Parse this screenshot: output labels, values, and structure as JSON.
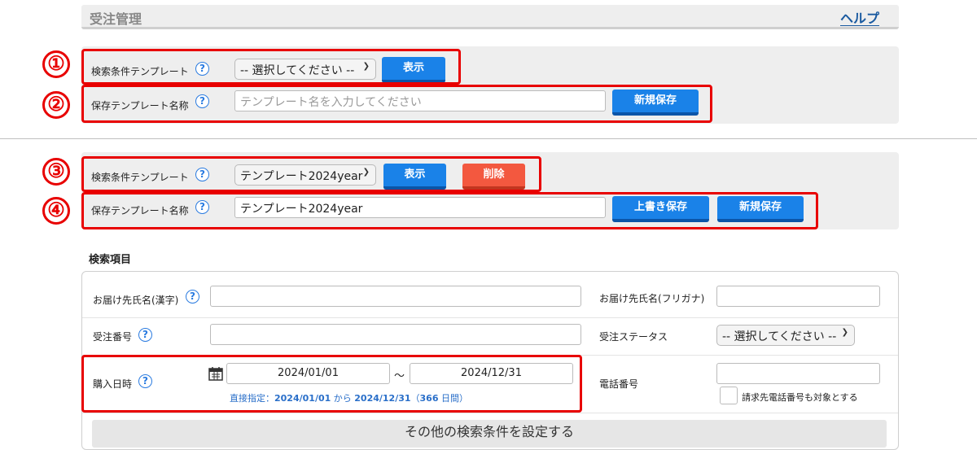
{
  "header": {
    "title": "受注管理",
    "help_link": "ヘルプ"
  },
  "badges": [
    "①",
    "②",
    "③",
    "④"
  ],
  "panel1": {
    "template_label": "検索条件テンプレート",
    "template_select": "-- 選択してください --",
    "show_button": "表示",
    "save_name_label": "保存テンプレート名称",
    "save_name_placeholder": "テンプレート名を入力してください",
    "new_save_button": "新規保存"
  },
  "panel2": {
    "template_label": "検索条件テンプレート",
    "template_select": "テンプレート2024year",
    "show_button": "表示",
    "delete_button": "削除",
    "save_name_label": "保存テンプレート名称",
    "save_name_value": "テンプレート2024year",
    "overwrite_button": "上書き保存",
    "new_save_button": "新規保存"
  },
  "search": {
    "section_title": "検索項目",
    "recipient_kanji_label": "お届け先氏名(漢字)",
    "recipient_kana_label": "お届け先氏名(フリガナ)",
    "order_no_label": "受注番号",
    "order_status_label": "受注ステータス",
    "order_status_select": "-- 選択してください --",
    "purchase_date_label": "購入日時",
    "date_from": "2024/01/01",
    "date_tilde": "～",
    "date_to": "2024/12/31",
    "date_hint_prefix": "直接指定：",
    "date_hint_from": "2024/01/01",
    "date_hint_kara": " から ",
    "date_hint_to": "2024/12/31",
    "date_hint_open": "（",
    "date_hint_days": "366",
    "date_hint_days_suffix": " 日間）",
    "phone_label": "電話番号",
    "billing_phone_checkbox_label": "請求先電話番号も対象とする",
    "more_conditions": "その他の検索条件を設定する"
  },
  "colors": {
    "primary_button": "#1a82e8",
    "danger_button": "#f3583f",
    "highlight": "#e80000",
    "help_link": "#1a5aa0"
  },
  "icons": [
    "help-question-icon",
    "calendar-icon",
    "chevron-down-icon"
  ]
}
